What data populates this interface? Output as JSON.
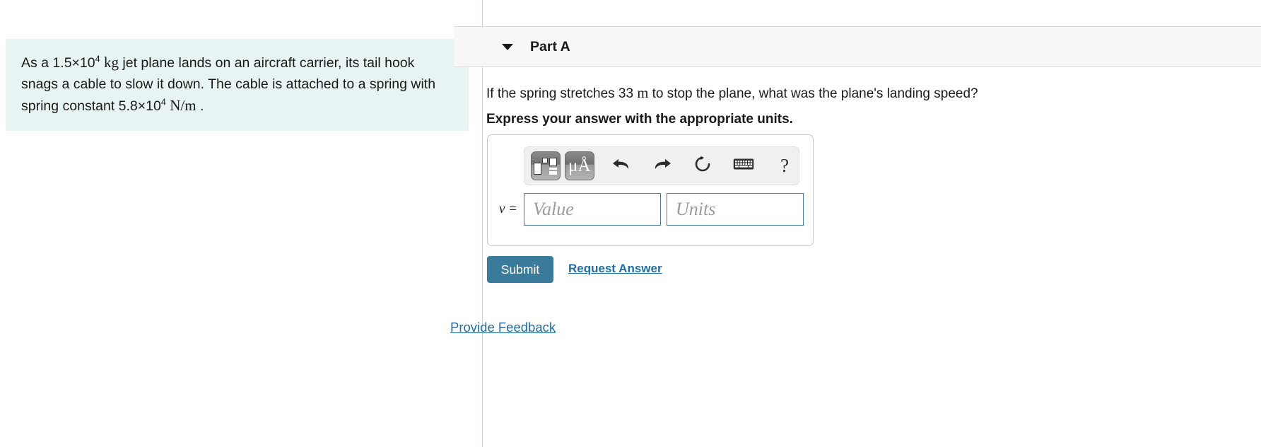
{
  "problem": {
    "line1_a": "As a 1.5×10",
    "line1_exp": "4",
    "line1_unit": "kg",
    "line1_b": " jet plane lands on an aircraft carrier, its tail hook snags a cable to slow it down. The cable is attached to a spring with spring constant 5.8×10",
    "line2_exp": "4",
    "line2_unit": "N/m",
    "line2_end": "."
  },
  "part": {
    "title": "Part A",
    "caret_icon": "caret-down-icon",
    "question_a": "If the spring stretches 33",
    "question_unit": "m",
    "question_b": "to stop the plane, what was the plane's landing speed?",
    "instruction": "Express your answer with the appropriate units."
  },
  "toolbar": {
    "template_button_label": "math-template",
    "units_button_label": "μÅ",
    "undo_label": "undo",
    "redo_label": "redo",
    "reset_label": "reset",
    "keyboard_label": "keyboard",
    "help_label": "?"
  },
  "answer": {
    "variable_label": "v =",
    "value_placeholder": "Value",
    "value": "",
    "units_placeholder": "Units",
    "units": ""
  },
  "actions": {
    "submit_label": "Submit",
    "request_answer_label": "Request Answer",
    "provide_feedback_label": "Provide Feedback"
  },
  "colors": {
    "problem_background": "#e8f4f4",
    "submit_background": "#3a7b9c",
    "link": "#1e6ea7",
    "header_background": "#f7f7f7",
    "input_border": "#4a7f9e"
  }
}
